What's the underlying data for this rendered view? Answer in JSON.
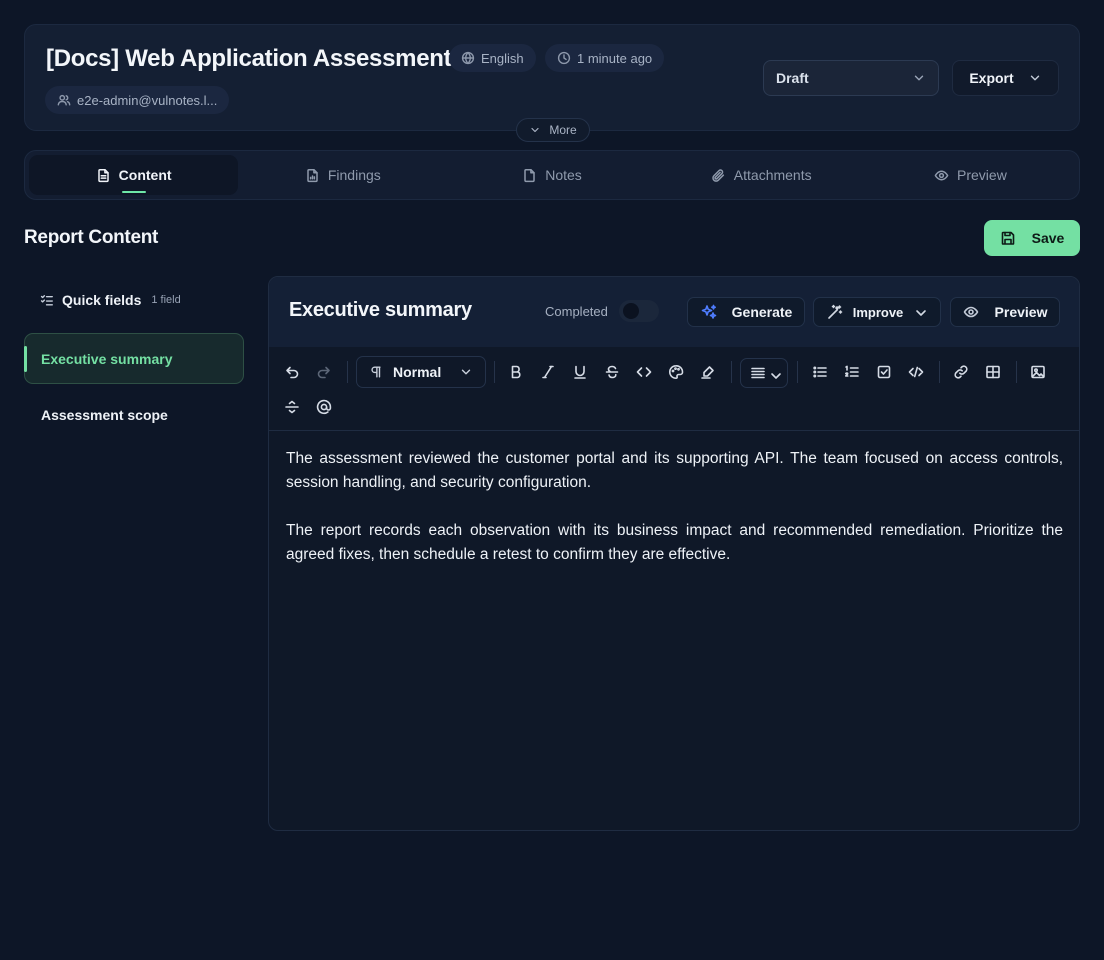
{
  "header": {
    "title": "[Docs] Web Application Assessment",
    "language": "English",
    "updated": "1 minute ago",
    "owner": "e2e-admin@vulnotes.l...",
    "status": "Draft",
    "export_label": "Export",
    "more_label": "More"
  },
  "tabs": [
    {
      "label": "Content",
      "icon": "file-text-icon",
      "active": true
    },
    {
      "label": "Findings",
      "icon": "file-chart-icon",
      "active": false
    },
    {
      "label": "Notes",
      "icon": "file-icon",
      "active": false
    },
    {
      "label": "Attachments",
      "icon": "paperclip-icon",
      "active": false
    },
    {
      "label": "Preview",
      "icon": "eye-icon",
      "active": false
    }
  ],
  "section": {
    "title": "Report Content",
    "save_label": "Save"
  },
  "sidebar": {
    "quick_fields": {
      "label": "Quick fields",
      "count": "1 field"
    },
    "items": [
      {
        "label": "Executive summary",
        "active": true
      },
      {
        "label": "Assessment scope",
        "active": false
      }
    ]
  },
  "editor": {
    "field_title": "Executive summary",
    "completed_label": "Completed",
    "completed": false,
    "generate_label": "Generate",
    "improve_label": "Improve",
    "preview_label": "Preview",
    "block_type": "Normal",
    "paragraphs": [
      "The assessment reviewed the customer portal and its supporting API. The team focused on access controls, session handling, and security configuration.",
      "The report records each observation with its business impact and recommended remediation. Prioritize the agreed fixes, then schedule a retest to confirm they are effective."
    ]
  },
  "colors": {
    "background": "#0d1627",
    "card": "#141f33",
    "accent_green": "#74e0a3",
    "accent_blue": "#4f7dff"
  }
}
